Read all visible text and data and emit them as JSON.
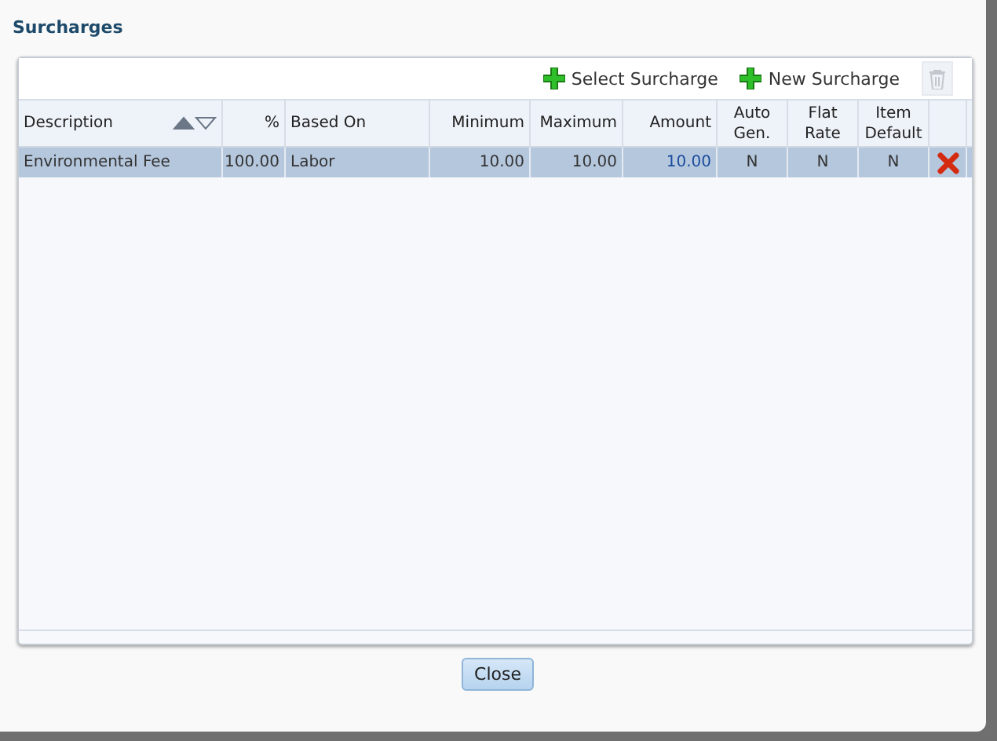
{
  "dialog": {
    "title": "Surcharges"
  },
  "toolbar": [
    {
      "label": "Select Surcharge",
      "kind": "add"
    },
    {
      "label": "New Surcharge",
      "kind": "add"
    },
    {
      "kind": "delete",
      "disabled": true
    }
  ],
  "table": {
    "columns": [
      {
        "label": "Description",
        "kind": "text",
        "sorted_ascending": true
      },
      {
        "label": "%",
        "kind": "number"
      },
      {
        "label": "Based On",
        "kind": "text"
      },
      {
        "label": "Minimum",
        "kind": "number"
      },
      {
        "label": "Maximum",
        "kind": "number"
      },
      {
        "label": "Amount",
        "kind": "number"
      },
      {
        "label": "Auto Gen.",
        "kind": "flag"
      },
      {
        "label": "Flat Rate",
        "kind": "flag"
      },
      {
        "label": "Item Default",
        "kind": "flag"
      },
      {
        "kind": "action"
      }
    ],
    "rows": [
      {
        "selected": true,
        "cells": [
          {
            "text": "Environmental Fee",
            "kind": "text"
          },
          {
            "text": "100.00",
            "kind": "text"
          },
          {
            "text": "Labor",
            "kind": "text"
          },
          {
            "text": "10.00",
            "kind": "text"
          },
          {
            "text": "10.00",
            "kind": "text"
          },
          {
            "text": "10.00",
            "kind": "link"
          },
          {
            "text": "N",
            "kind": "text"
          },
          {
            "text": "N",
            "kind": "text"
          },
          {
            "text": "N",
            "kind": "text"
          },
          {
            "kind": "remove"
          }
        ]
      }
    ]
  },
  "buttons": [
    "Close"
  ]
}
